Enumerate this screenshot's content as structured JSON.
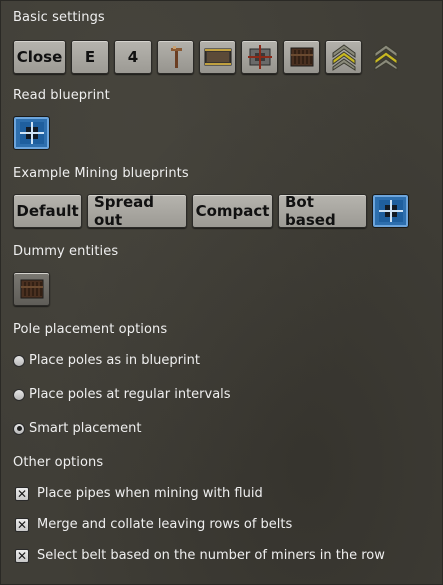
{
  "sections": {
    "basic_settings": "Basic settings",
    "read_blueprint": "Read blueprint",
    "example_blueprints": "Example Mining blueprints",
    "dummy_entities": "Dummy entities",
    "pole_placement": "Pole placement options",
    "other_options": "Other options"
  },
  "basic_buttons": {
    "close": "Close",
    "e": "E",
    "four": "4"
  },
  "basic_icons": [
    "pole-icon",
    "belt-icon",
    "drill-icon",
    "chest-icon",
    "upgrade-icon",
    "upgrade-icon"
  ],
  "example_buttons": [
    "Default",
    "Spread out",
    "Compact",
    "Bot based"
  ],
  "pole_options": [
    {
      "label": "Place poles as in blueprint",
      "selected": false
    },
    {
      "label": "Place poles at regular intervals",
      "selected": false
    },
    {
      "label": "Smart placement",
      "selected": true
    }
  ],
  "other_options": [
    {
      "label": "Place pipes when mining with fluid",
      "checked": true
    },
    {
      "label": "Merge and collate leaving rows of belts",
      "checked": true
    },
    {
      "label": "Select belt based on the number of miners in the row",
      "checked": true
    }
  ],
  "colors": {
    "background": "#403e37",
    "button": "#a8a6a0",
    "selected_blue": "#2e6fae"
  }
}
